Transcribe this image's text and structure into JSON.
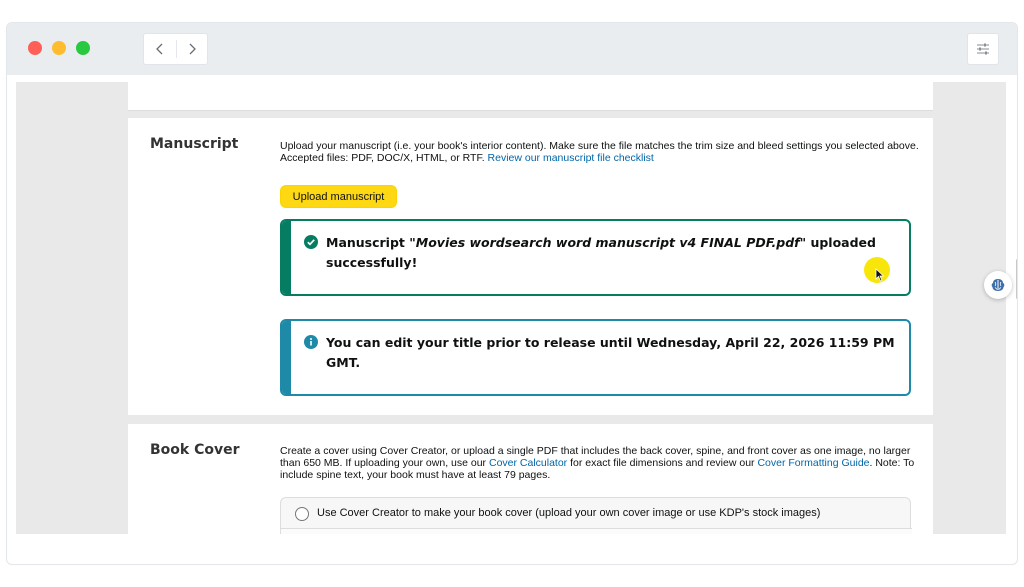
{
  "browser": {
    "back_icon": "chevron-left-icon",
    "forward_icon": "chevron-right-icon",
    "menu_icon": "sliders-icon"
  },
  "manuscript": {
    "title": "Manuscript",
    "description": "Upload your manuscript (i.e. your book's interior content). Make sure the file matches the trim size and bleed settings you selected above. Accepted files: PDF, DOC/X, HTML, or RTF.",
    "checklist_link": "Review our manuscript file checklist",
    "upload_button": "Upload manuscript",
    "success_prefix": "Manuscript \"",
    "success_filename": "Movies wordsearch word manuscript v4 FINAL PDF.pdf",
    "success_suffix": "\" uploaded successfully!",
    "info_message": "You can edit your title prior to release until Wednesday, April 22, 2026 11:59 PM GMT."
  },
  "book_cover": {
    "title": "Book Cover",
    "description_1": "Create a cover using Cover Creator, or upload a single PDF that includes the back cover, spine, and front cover as one image, no larger than 650 MB. If uploading your own, use our",
    "cover_calculator_link": "Cover Calculator",
    "description_2": "for exact file dimensions and review our",
    "formatting_guide_link": "Cover Formatting Guide",
    "description_3": ". Note: To include spine text, your book must have at least 79 pages.",
    "option_cover_creator": "Use Cover Creator to make your book cover (upload your own cover image or use KDP's stock images)"
  },
  "colors": {
    "success": "#067d62",
    "info": "#1f8aa8",
    "button": "#ffd814",
    "link": "#0066a8"
  }
}
